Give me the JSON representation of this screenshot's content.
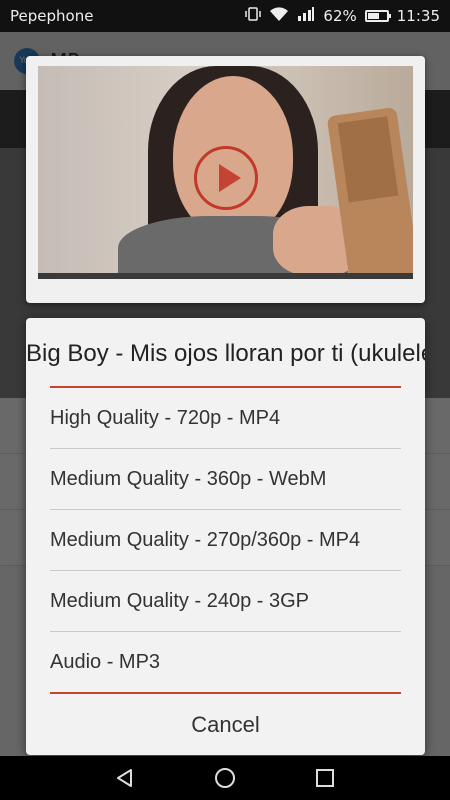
{
  "statusbar": {
    "carrier": "Pepephone",
    "battery": "62%",
    "time": "11:35",
    "battery_level": 0.62,
    "icons": [
      "vibrate-icon",
      "wifi-icon",
      "signal-icon",
      "battery-icon"
    ]
  },
  "background_app": {
    "title": "MP"
  },
  "video": {
    "play_icon": "play-circle-icon",
    "play_color": "#c0392b"
  },
  "dialog": {
    "title": "Big Boy - Mis ojos lloran por ti (ukulele",
    "options": [
      "High Quality - 720p - MP4",
      "Medium Quality - 360p - WebM",
      "Medium Quality - 270p/360p - MP4",
      "Medium Quality - 240p - 3GP",
      "Audio - MP3"
    ],
    "cancel_label": "Cancel",
    "accent_color": "#c9442f"
  },
  "navbar": {
    "icons": [
      "back-icon",
      "home-icon",
      "recents-icon"
    ]
  }
}
